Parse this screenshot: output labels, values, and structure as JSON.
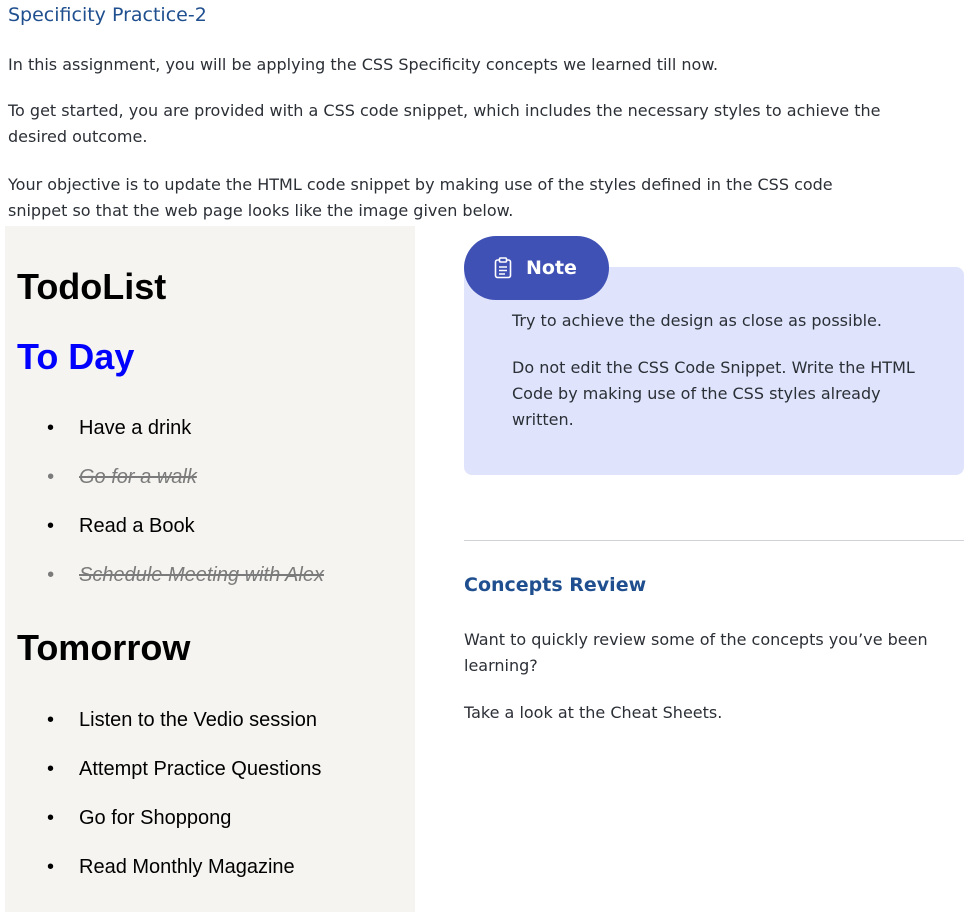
{
  "assignment": {
    "title": "Specificity Practice-2",
    "paragraphs": [
      "In this assignment, you will be applying the CSS Specificity concepts we learned till now.",
      "To get started, you are provided with a CSS code snippet, which includes the necessary styles to achieve the desired outcome.",
      "Your objective is to update the HTML code snippet by making use of the styles defined in the CSS code snippet so that the web page looks like the image given below."
    ]
  },
  "preview": {
    "title": "TodoList",
    "today_heading": "To Day",
    "today_items": [
      {
        "text": "Have a drink",
        "done": false
      },
      {
        "text": "Go for a walk",
        "done": true
      },
      {
        "text": "Read a Book",
        "done": false
      },
      {
        "text": "Schedule Meeting with Alex",
        "done": true
      }
    ],
    "tomorrow_heading": "Tomorrow",
    "tomorrow_items": [
      {
        "text": "Listen to the Vedio session",
        "done": false
      },
      {
        "text": "Attempt Practice Questions",
        "done": false
      },
      {
        "text": "Go for Shoppong",
        "done": false
      },
      {
        "text": "Read Monthly Magazine",
        "done": false
      }
    ]
  },
  "note": {
    "label": "Note",
    "icon": "clipboard-icon",
    "lines": [
      "Try to achieve the design as close as possible.",
      "Do not edit the CSS Code Snippet. Write the HTML Code by making use of the CSS styles already written."
    ]
  },
  "concepts": {
    "heading": "Concepts Review",
    "lines": [
      "Want to quickly review some of the concepts you’ve been learning?",
      "Take a look at the Cheat Sheets."
    ]
  },
  "colors": {
    "title_blue": "#1f4f8f",
    "note_pill": "#3f51b5",
    "note_bg": "#dfe4fc",
    "today_blue": "#0000ff",
    "done_gray": "#7b7b7b"
  }
}
